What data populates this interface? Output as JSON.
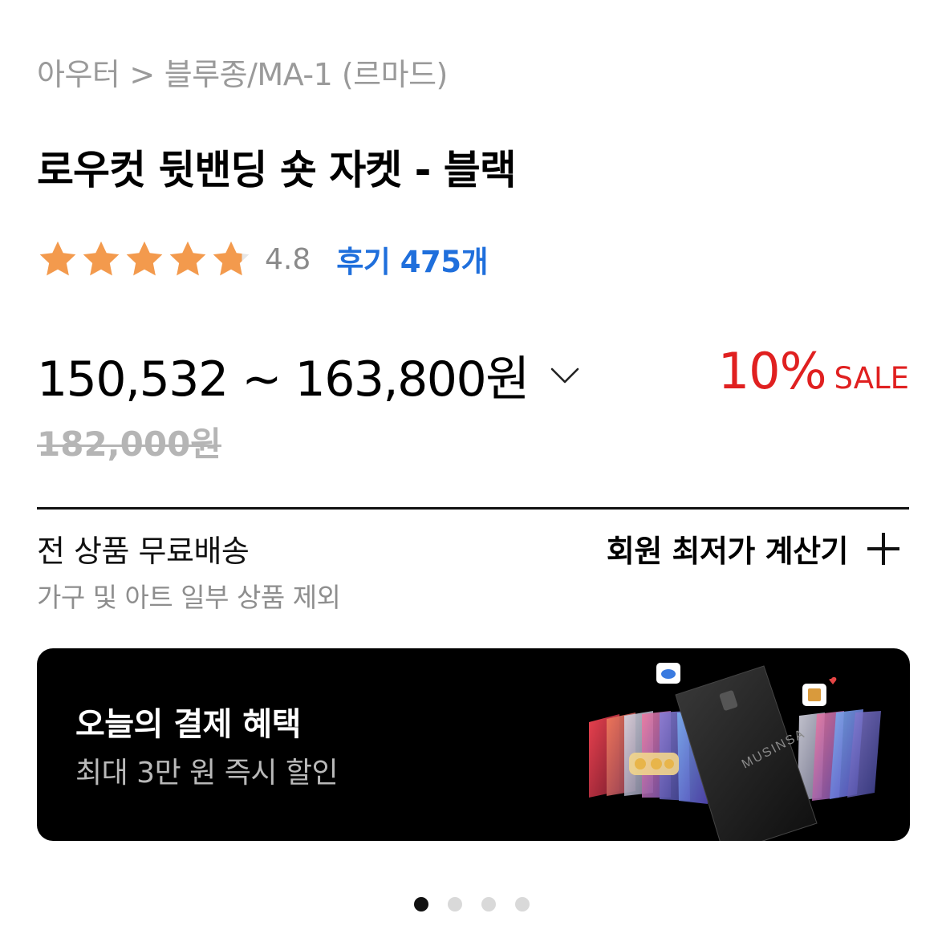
{
  "breadcrumb": {
    "category": "아우터",
    "separator": ">",
    "subcategory": "블루종/MA-1 (르마드)"
  },
  "product": {
    "title": "로우컷 뒷밴딩 숏 자켓 - 블랙",
    "rating": {
      "stars": 4.8,
      "score_text": "4.8",
      "star_color": "#f39a4d",
      "reviews_text": "후기 475개",
      "review_color": "#1f6fdc"
    },
    "price": {
      "range_text": "150,532 ~ 163,800원",
      "sale_percent": "10%",
      "sale_label": "SALE",
      "sale_color": "#e02020",
      "original_text": "182,000원"
    }
  },
  "shipping": {
    "title": "전 상품 무료배송",
    "subtitle": "가구 및 아트 일부 상품 제외"
  },
  "calculator": {
    "label": "회원 최저가 계산기",
    "icon": "plus-icon"
  },
  "banner": {
    "title": "오늘의 결제 혜택",
    "subtitle": "최대 3만 원 즉시 할인",
    "card_brand": "MUSINSA"
  },
  "carousel": {
    "total": 4,
    "active_index": 0
  }
}
